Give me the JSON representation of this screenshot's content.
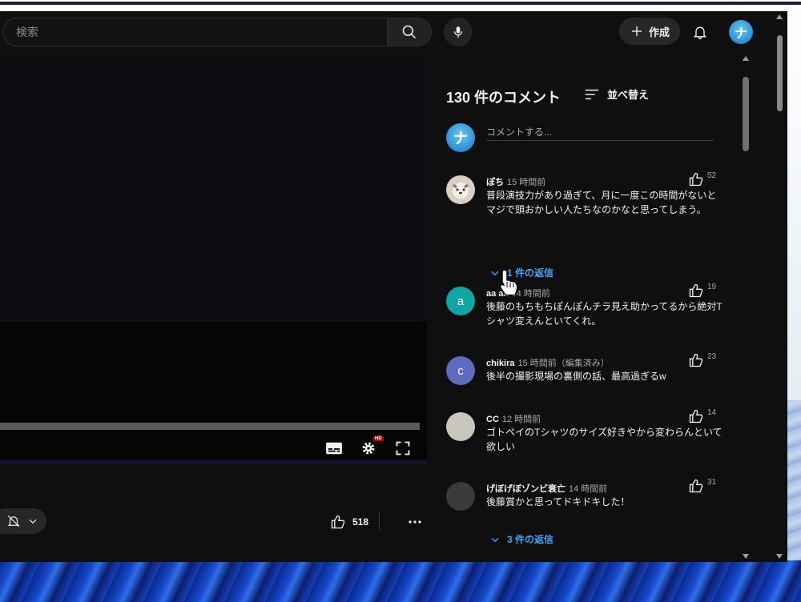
{
  "header": {
    "search_placeholder": "検索",
    "create_label": "作成",
    "profile_initial": "ナ"
  },
  "player": {
    "hd_badge": "HD"
  },
  "actions": {
    "like_count": "518"
  },
  "comments": {
    "count_label": "130 件のコメント",
    "sort_label": "並べ替え",
    "input_placeholder": "コメントする...",
    "items": [
      {
        "author": "ぽち",
        "time": "15 時間前",
        "text": "普段演技力があり過ぎて、月に一度この時間がないとマジで頭おかしい人たちなのかなと思ってしまう。",
        "likes": "52",
        "avatar_color": "#d9cfc2"
      },
      {
        "author": "aa aa",
        "time": "14 時間前",
        "text": "後藤のもちもちぽんぽんチラ見え助かってるから絶対Tシャツ変えんといてくれ。",
        "likes": "19",
        "avatar_initial": "a",
        "avatar_color": "#12a4a4"
      },
      {
        "author": "chikira",
        "time": "15 時間前（編集済み）",
        "text": "後半の撮影現場の裏側の話、最高過ぎるw",
        "likes": "23",
        "avatar_initial": "c",
        "avatar_color": "#5c6bc0"
      },
      {
        "author": "CC",
        "time": "12 時間前",
        "text": "ゴトペイのTシャツのサイズ好きやから変わらんといて欲しい",
        "likes": "14",
        "avatar_color": "#c9c6bc"
      },
      {
        "author": "げぼげぼゾンビ衰亡",
        "time": "14 時間前",
        "text": "後藤賞かと思ってドキドキした！",
        "likes": "31",
        "avatar_color": "#3a3a3a"
      }
    ],
    "replies_1": "1 件の返信",
    "replies_5": "3 件の返信"
  },
  "colors": {
    "accent_link": "#3ea6ff",
    "background": "#0f0f0f"
  }
}
